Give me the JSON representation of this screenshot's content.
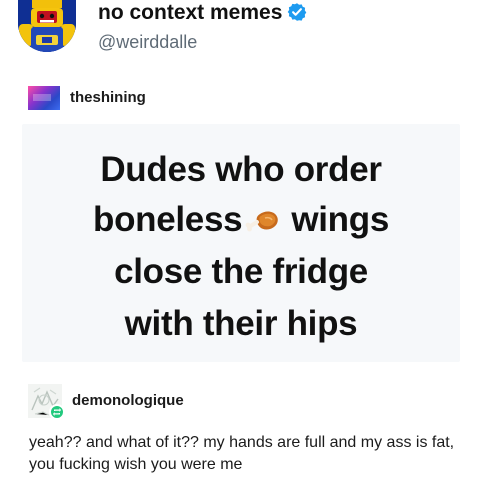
{
  "tweet": {
    "display_name": "no context memes",
    "handle": "@weirddalle",
    "verified": true,
    "avatar_icon": "lego-wrestler-avatar",
    "verified_icon": "verified-badge-icon",
    "verified_color": "#1d9bf0"
  },
  "post": {
    "author": "theshining",
    "author_avatar_colors": [
      "#ff4ea6",
      "#8a33cc",
      "#3d6cf0"
    ]
  },
  "meme": {
    "line_1": "Dudes who order",
    "line_2_part_1": "boneless",
    "line_2_part_2": "wings",
    "line_3": "close the fridge",
    "line_4": "with their hips",
    "inline_icon": "drumstick-icon",
    "background": "#f6f8fa"
  },
  "reply": {
    "author": "demonologique",
    "text": "yeah?? and what of it?? my hands are full and my ass is fat, you fucking wish you were me",
    "badge_icon": "reblog-icon",
    "badge_color": "#23c97e"
  }
}
